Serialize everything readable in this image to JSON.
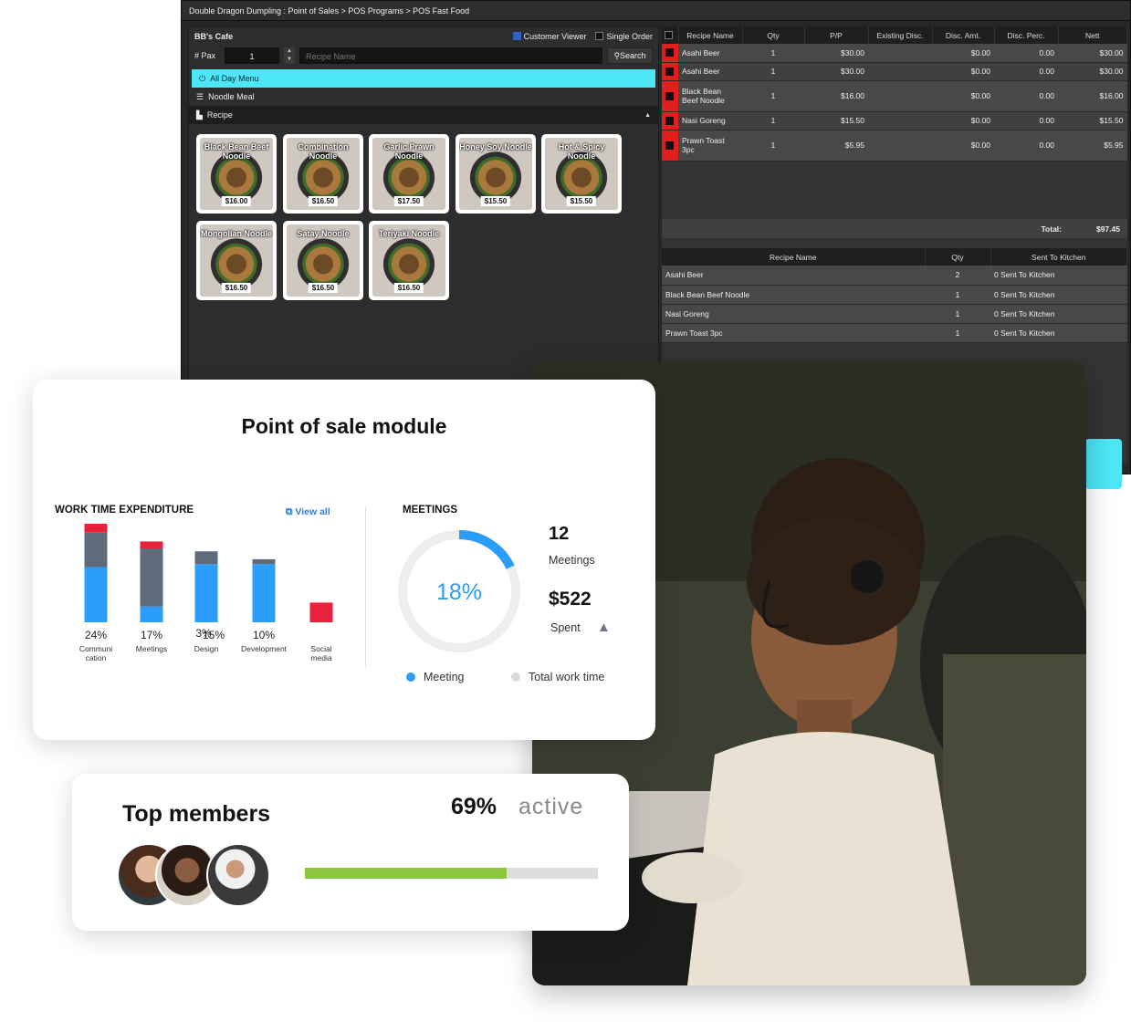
{
  "pos": {
    "breadcrumb": "Double Dragon Dumpling : Point of Sales > POS Programs > POS Fast Food",
    "cafe_name": "BB's Cafe",
    "customer_viewer": "Customer Viewer",
    "single_order": "Single Order",
    "pax_label": "# Pax",
    "pax_value": "1",
    "recipe_placeholder": "Recipe Name",
    "search_label": "Search",
    "menus": [
      "All Day Menu",
      "Noodle Meal"
    ],
    "recipe_label": "Recipe",
    "items": [
      {
        "name": "Black Bean Beef Noodle",
        "price": "$16.00"
      },
      {
        "name": "Combination Noodle",
        "price": "$16.50"
      },
      {
        "name": "Garlic Prawn Noodle",
        "price": "$17.50"
      },
      {
        "name": "Honey Soy Noodle",
        "price": "$15.50"
      },
      {
        "name": "Hot & Spicy Noodle",
        "price": "$15.50"
      },
      {
        "name": "Mongolian Noodle",
        "price": "$16.50"
      },
      {
        "name": "Satay Noodle",
        "price": "$16.50"
      },
      {
        "name": "Teriyaki Noodle",
        "price": "$16.50"
      }
    ],
    "order_headers": [
      "Recipe Name",
      "Qty",
      "P/P",
      "Existing Disc.",
      "Disc. Amt.",
      "Disc. Perc.",
      "Nett"
    ],
    "order_rows": [
      {
        "name": "Asahi Beer",
        "qty": "1",
        "pp": "$30.00",
        "existing": "",
        "amt": "$0.00",
        "perc": "0.00",
        "nett": "$30.00"
      },
      {
        "name": "Asahi Beer",
        "qty": "1",
        "pp": "$30.00",
        "existing": "",
        "amt": "$0.00",
        "perc": "0.00",
        "nett": "$30.00"
      },
      {
        "name": "Black Bean Beef Noodle",
        "qty": "1",
        "pp": "$16.00",
        "existing": "",
        "amt": "$0.00",
        "perc": "0.00",
        "nett": "$16.00"
      },
      {
        "name": "Nasi Goreng",
        "qty": "1",
        "pp": "$15.50",
        "existing": "",
        "amt": "$0.00",
        "perc": "0.00",
        "nett": "$15.50"
      },
      {
        "name": "Prawn Toast 3pc",
        "qty": "1",
        "pp": "$5.95",
        "existing": "",
        "amt": "$0.00",
        "perc": "0.00",
        "nett": "$5.95"
      }
    ],
    "total_label": "Total:",
    "total_value": "$97.45",
    "sent_headers": [
      "Recipe Name",
      "Qty",
      "Sent To Kitchen"
    ],
    "sent_rows": [
      {
        "name": "Asahi Beer",
        "qty": "2",
        "sent": "0 Sent To Kitchen"
      },
      {
        "name": "Black Bean Beef Noodle",
        "qty": "1",
        "sent": "0 Sent To Kitchen"
      },
      {
        "name": "Nasi Goreng",
        "qty": "1",
        "sent": "0 Sent To Kitchen"
      },
      {
        "name": "Prawn Toast 3pc",
        "qty": "1",
        "sent": "0 Sent To Kitchen"
      }
    ]
  },
  "module": {
    "title": "Point of sale module",
    "work_title": "WORK TIME EXPENDITURE",
    "view_all": "View all",
    "meetings_title": "MEETINGS",
    "meetings_percent": "18%",
    "meetings_fraction": 0.18,
    "meetings_count": "12",
    "meetings_label": "Meetings",
    "spent_value": "$522",
    "spent_label": "Spent",
    "legend_meeting": "Meeting",
    "legend_total": "Total work time"
  },
  "chart_data": {
    "type": "bar",
    "categories": [
      "Communi cation",
      "Meetings",
      "Design",
      "Development",
      "Social media"
    ],
    "value_labels": [
      "24%",
      "17%",
      "15%",
      "10%",
      ""
    ],
    "extra_label": "3%",
    "stack_order": [
      "blue",
      "gray",
      "red"
    ],
    "stacks": [
      [
        0.56,
        0.35,
        0.09
      ],
      [
        0.16,
        0.59,
        0.07
      ],
      [
        0.59,
        0.13,
        0
      ],
      [
        0.59,
        0.05,
        0
      ],
      [
        0,
        0,
        0.2
      ]
    ],
    "colors": {
      "blue": "#2b9dfa",
      "gray": "#5f6b7a",
      "red": "#e8223b"
    }
  },
  "members": {
    "title": "Top members",
    "active_percent": "69%",
    "active_label": "active",
    "active_fraction": 0.69,
    "bar_color": "#8dc63f"
  }
}
